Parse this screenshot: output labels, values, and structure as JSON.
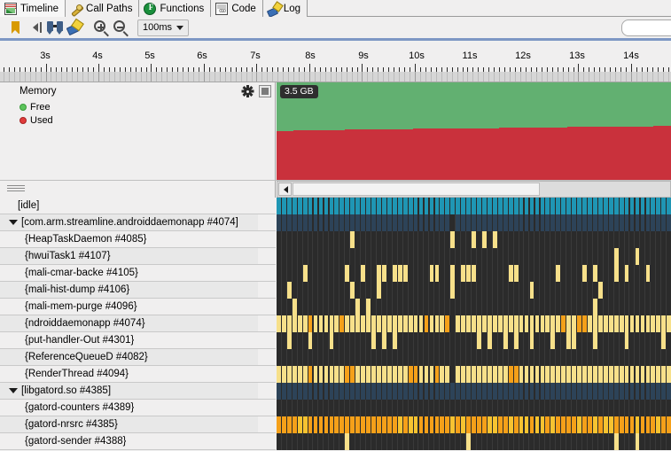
{
  "tabs": [
    {
      "label": "Timeline",
      "icon": "timeline-chart-icon",
      "active": true
    },
    {
      "label": "Call Paths",
      "icon": "call-paths-icon",
      "active": false
    },
    {
      "label": "Functions",
      "icon": "functions-icon",
      "active": false
    },
    {
      "label": "Code",
      "icon": "code-icon",
      "active": false
    },
    {
      "label": "Log",
      "icon": "log-icon",
      "active": false
    }
  ],
  "toolbar": {
    "bookmark_label": "Bookmark",
    "marker_prev_label": "Jump to previous marker",
    "marker_range_label": "Marker range",
    "annotate_label": "Annotations",
    "zoom_in_label": "Zoom in",
    "zoom_out_label": "Zoom out",
    "zoom_value": "100ms",
    "search_value": "",
    "search_placeholder": ""
  },
  "ruler": {
    "unit": "s",
    "labels": [
      "3s",
      "4s",
      "5s",
      "6s",
      "7s",
      "8s",
      "9s",
      "10s",
      "11s",
      "12s",
      "13s",
      "14s"
    ],
    "label_positions": [
      51,
      110,
      169,
      228,
      288,
      350,
      410,
      470,
      530,
      590,
      651,
      712
    ],
    "minor_tick_spacing": 5.95,
    "tick_start": -8
  },
  "memory": {
    "title": "Memory",
    "legend": [
      {
        "label": "Free",
        "color": "#5cc45c"
      },
      {
        "label": "Used",
        "color": "#e03b3b"
      }
    ],
    "settings_icon": "gear-icon",
    "visibility_icon": "checkbox-filled-icon",
    "scale_label": "3.5 GB",
    "chart_bg": "#1b1b1b"
  },
  "chart_data": {
    "type": "area",
    "title": "Memory",
    "subtitle": "3.5 GB",
    "stacked": true,
    "xlabel": "",
    "ylabel": "",
    "ylim": [
      0,
      3.5
    ],
    "yunit": "GB",
    "grid": true,
    "legend_position": "left-panel",
    "x": [
      3,
      3.5,
      4,
      4.5,
      5,
      5.5,
      6,
      6.5,
      7,
      7.5,
      8,
      8.5,
      9,
      9.5,
      10,
      10.5,
      11,
      11.5,
      12,
      12.5,
      13,
      13.5,
      14,
      14.5
    ],
    "series": [
      {
        "name": "Free",
        "color": "#62b071",
        "values": [
          1.74,
          1.74,
          1.72,
          1.72,
          1.7,
          1.7,
          1.69,
          1.69,
          1.67,
          1.67,
          1.66,
          1.66,
          1.64,
          1.64,
          1.63,
          1.63,
          1.61,
          1.61,
          1.6,
          1.6,
          1.58,
          1.58,
          1.57,
          1.57
        ]
      },
      {
        "name": "Used",
        "color": "#c9313c",
        "values": [
          1.76,
          1.76,
          1.78,
          1.78,
          1.8,
          1.8,
          1.81,
          1.81,
          1.83,
          1.83,
          1.84,
          1.84,
          1.86,
          1.86,
          1.87,
          1.87,
          1.89,
          1.89,
          1.9,
          1.9,
          1.92,
          1.92,
          1.93,
          1.93
        ]
      }
    ]
  },
  "scrollbar": {
    "left_arrow_icon": "chevron-left-icon",
    "thumb_start_pct": 0,
    "thumb_width_pct": 63
  },
  "threads": [
    {
      "label": "[idle]",
      "indent": 20,
      "expander": false,
      "track": "idle",
      "density": 1.0
    },
    {
      "label": "[com.arm.streamline.androiddaemonapp #4074]",
      "indent": 0,
      "expander": true,
      "track": "process",
      "density": 1.0
    },
    {
      "label": "{HeapTaskDaemon #4085}",
      "indent": 28,
      "expander": false,
      "track": "sparse",
      "density": 0.045
    },
    {
      "label": "{hwuiTask1 #4107}",
      "indent": 28,
      "expander": false,
      "track": "sparse",
      "density": 0.03
    },
    {
      "label": "{mali-cmar-backe #4105}",
      "indent": 28,
      "expander": false,
      "track": "medium",
      "density": 0.24
    },
    {
      "label": "{mali-hist-dump #4106}",
      "indent": 28,
      "expander": false,
      "track": "sparse",
      "density": 0.055
    },
    {
      "label": "{mali-mem-purge #4096}",
      "indent": 28,
      "expander": false,
      "track": "sparse",
      "density": 0.04
    },
    {
      "label": "{ndroiddaemonapp #4074}",
      "indent": 28,
      "expander": false,
      "track": "dense",
      "density": 0.96
    },
    {
      "label": "{put-handler-Out #4301}",
      "indent": 28,
      "expander": false,
      "track": "medium",
      "density": 0.2
    },
    {
      "label": "{ReferenceQueueD #4082}",
      "indent": 28,
      "expander": false,
      "track": "empty",
      "density": 0.0
    },
    {
      "label": "{RenderThread #4094}",
      "indent": 28,
      "expander": false,
      "track": "dense",
      "density": 0.95
    },
    {
      "label": "[libgatord.so #4385]",
      "indent": 0,
      "expander": true,
      "track": "process",
      "density": 1.0
    },
    {
      "label": "{gatord-counters #4389}",
      "indent": 28,
      "expander": false,
      "track": "sparse",
      "density": 0.012
    },
    {
      "label": "{gatord-nrsrc #4385}",
      "indent": 28,
      "expander": false,
      "track": "orange",
      "density": 1.0
    },
    {
      "label": "{gatord-sender #4388}",
      "indent": 28,
      "expander": false,
      "track": "sparse",
      "density": 0.035
    }
  ],
  "colors": {
    "idle_track": "#1f96b4",
    "process_track": "#2d4358",
    "activity_yellow": "#f7e08a",
    "activity_orange": "#f5a019",
    "track_bg": "#2b2b2b",
    "panel_bg": "#f0efef",
    "accent_blue": "#7d97c4"
  }
}
